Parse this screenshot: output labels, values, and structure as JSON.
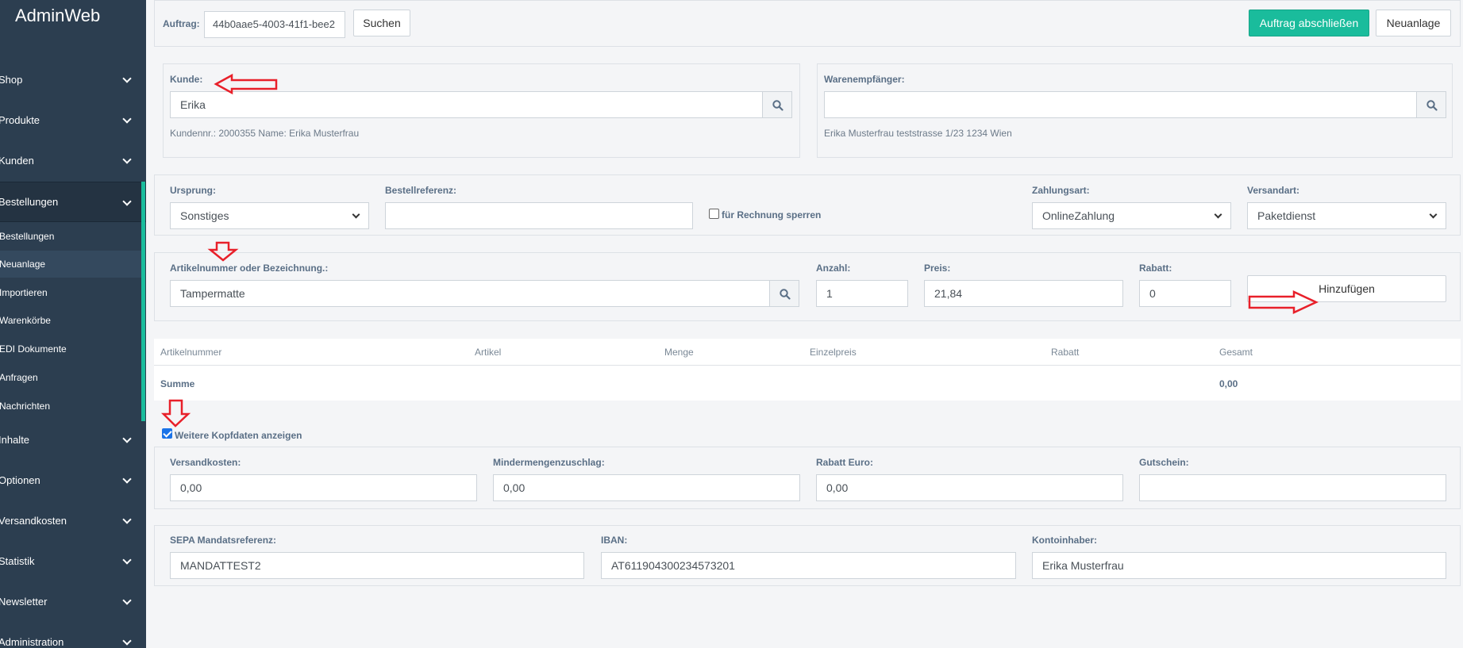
{
  "app": {
    "brand": "AdminWeb"
  },
  "sidebar": {
    "items": [
      {
        "label": "Shop"
      },
      {
        "label": "Produkte"
      },
      {
        "label": "Kunden"
      },
      {
        "label": "Bestellungen"
      },
      {
        "label": "Inhalte"
      },
      {
        "label": "Optionen"
      },
      {
        "label": "Versandkosten"
      },
      {
        "label": "Statistik"
      },
      {
        "label": "Newsletter"
      },
      {
        "label": "Administration"
      }
    ],
    "submenu": [
      {
        "label": "Bestellungen"
      },
      {
        "label": "Neuanlage"
      },
      {
        "label": "Importieren"
      },
      {
        "label": "Warenkörbe"
      },
      {
        "label": "EDI Dokumente"
      },
      {
        "label": "Anfragen"
      },
      {
        "label": "Nachrichten"
      }
    ]
  },
  "topbar": {
    "order_label": "Auftrag:",
    "order_value": "44b0aae5-4003-41f1-bee2",
    "search_button": "Suchen",
    "finish_button": "Auftrag abschließen",
    "new_button": "Neuanlage"
  },
  "customer": {
    "label": "Kunde:",
    "value": "Erika",
    "info": "Kundennr.: 2000355 Name: Erika Musterfrau"
  },
  "recipient": {
    "label": "Warenempfänger:",
    "value": "",
    "info": "Erika Musterfrau teststrasse 1/23 1234 Wien"
  },
  "order_meta": {
    "origin_label": "Ursprung:",
    "origin_value": "Sonstiges",
    "reference_label": "Bestellreferenz:",
    "reference_value": "",
    "lock_label": "für Rechnung sperren",
    "payment_label": "Zahlungsart:",
    "payment_value": "OnlineZahlung",
    "shipping_label": "Versandart:",
    "shipping_value": "Paketdienst"
  },
  "article": {
    "article_label": "Artikelnummer oder Bezeichnung.:",
    "article_value": "Tampermatte",
    "qty_label": "Anzahl:",
    "qty_value": "1",
    "price_label": "Preis:",
    "price_value": "21,84",
    "discount_label": "Rabatt:",
    "discount_value": "0",
    "add_button": "Hinzufügen"
  },
  "table": {
    "headers": [
      "Artikelnummer",
      "Artikel",
      "Menge",
      "Einzelpreis",
      "Rabatt",
      "Gesamt"
    ],
    "sum_label": "Summe",
    "sum_value": "0,00"
  },
  "more_header": {
    "checkbox_label": "Weitere Kopfdaten anzeigen",
    "checked": true,
    "shipping_cost_label": "Versandkosten:",
    "shipping_cost_value": "0,00",
    "min_qty_label": "Mindermengenzuschlag:",
    "min_qty_value": "0,00",
    "discount_euro_label": "Rabatt Euro:",
    "discount_euro_value": "0,00",
    "voucher_label": "Gutschein:",
    "voucher_value": ""
  },
  "sepa": {
    "mandate_label": "SEPA Mandatsreferenz:",
    "mandate_value": "MANDATTEST2",
    "iban_label": "IBAN:",
    "iban_value": "AT611904300234573201",
    "holder_label": "Kontoinhaber:",
    "holder_value": "Erika Musterfrau"
  },
  "colors": {
    "sidebar": "#2c3e50",
    "accent": "#1abc9c",
    "annotation": "#e8202a"
  },
  "icons": [
    "search-icon",
    "chevron-down-icon",
    "arrow-left-annotation",
    "arrow-down-annotation",
    "arrow-right-annotation"
  ]
}
